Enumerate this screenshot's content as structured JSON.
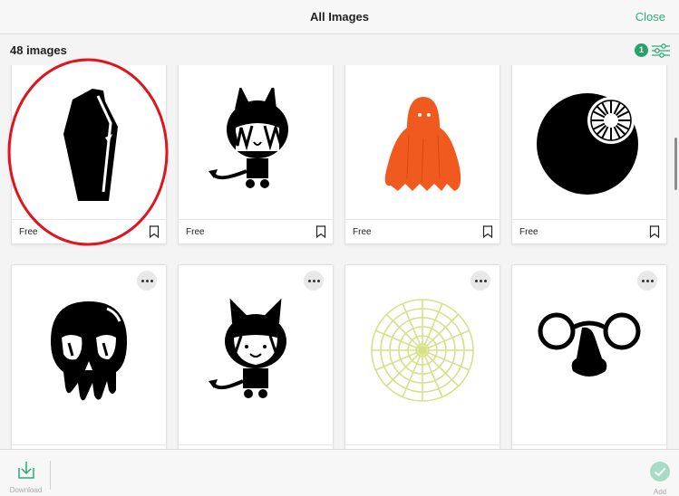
{
  "header": {
    "title": "All Images",
    "close_label": "Close"
  },
  "toolbar": {
    "image_count": "48 images",
    "filter_count": "1",
    "filter_icon": "sliders-icon"
  },
  "cards": [
    {
      "price": "Free",
      "image": "coffin"
    },
    {
      "price": "Free",
      "image": "devil-girl"
    },
    {
      "price": "Free",
      "image": "ghost"
    },
    {
      "price": "Free",
      "image": "eyeball"
    },
    {
      "price": "",
      "image": "melting-skull"
    },
    {
      "price": "",
      "image": "devil-girl-horns"
    },
    {
      "price": "",
      "image": "spider-web"
    },
    {
      "price": "",
      "image": "disguise-glasses"
    }
  ],
  "colors": {
    "accent": "#2daa73",
    "ghost": "#f05a1f",
    "web": "#d7e08a",
    "annotation": "#e0141f"
  },
  "footer": {
    "download_label": "Download",
    "add_label": "Add"
  }
}
